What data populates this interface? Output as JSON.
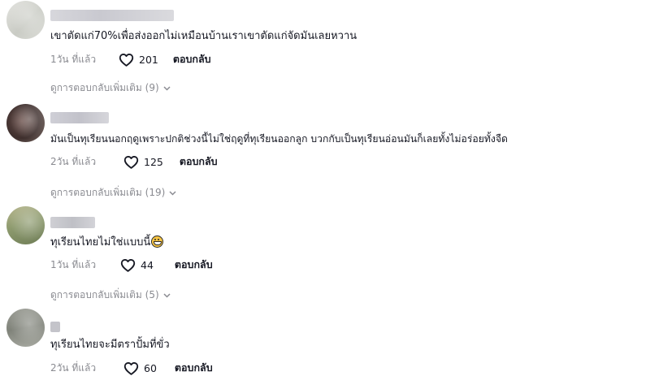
{
  "comments": [
    {
      "text": "เขาตัดแก่70%เพื่อส่งออกไม่เหมือนบ้านเราเขาตัดแก่จัดมันเลยหวาน",
      "time": "1วัน ที่แล้ว",
      "likes": "201",
      "reply_label": "ตอบกลับ",
      "more_replies": "ดูการตอบกลับเพิ่มเติม (9)"
    },
    {
      "text": "มันเป็นทุเรียนนอกฤดูเพราะปกติช่วงนี้ไม่ใช่ฤดูที่ทุเรียนออกลูก บวกกับเป็นทุเรียนอ่อนมันก็เลยทั้งไม่อร่อยทั้งจืด",
      "time": "2วัน ที่แล้ว",
      "likes": "125",
      "reply_label": "ตอบกลับ",
      "more_replies": "ดูการตอบกลับเพิ่มเติม (19)"
    },
    {
      "text": "ทุเรียนไทยไม่ใช่แบบนี้",
      "time": "1วัน ที่แล้ว",
      "likes": "44",
      "reply_label": "ตอบกลับ",
      "more_replies": "ดูการตอบกลับเพิ่มเติม (5)"
    },
    {
      "text": "ทุเรียนไทยจะมีตราปั้มที่ขั่ว",
      "time": "2วัน ที่แล้ว",
      "likes": "60",
      "reply_label": "ตอบกลับ"
    }
  ],
  "icons": {
    "like": "heart-outline-icon",
    "expand": "chevron-down-icon",
    "emoji": "grinning-sweat-emoji"
  },
  "colors": {
    "text": "#161823",
    "muted": "#8a8b91"
  }
}
